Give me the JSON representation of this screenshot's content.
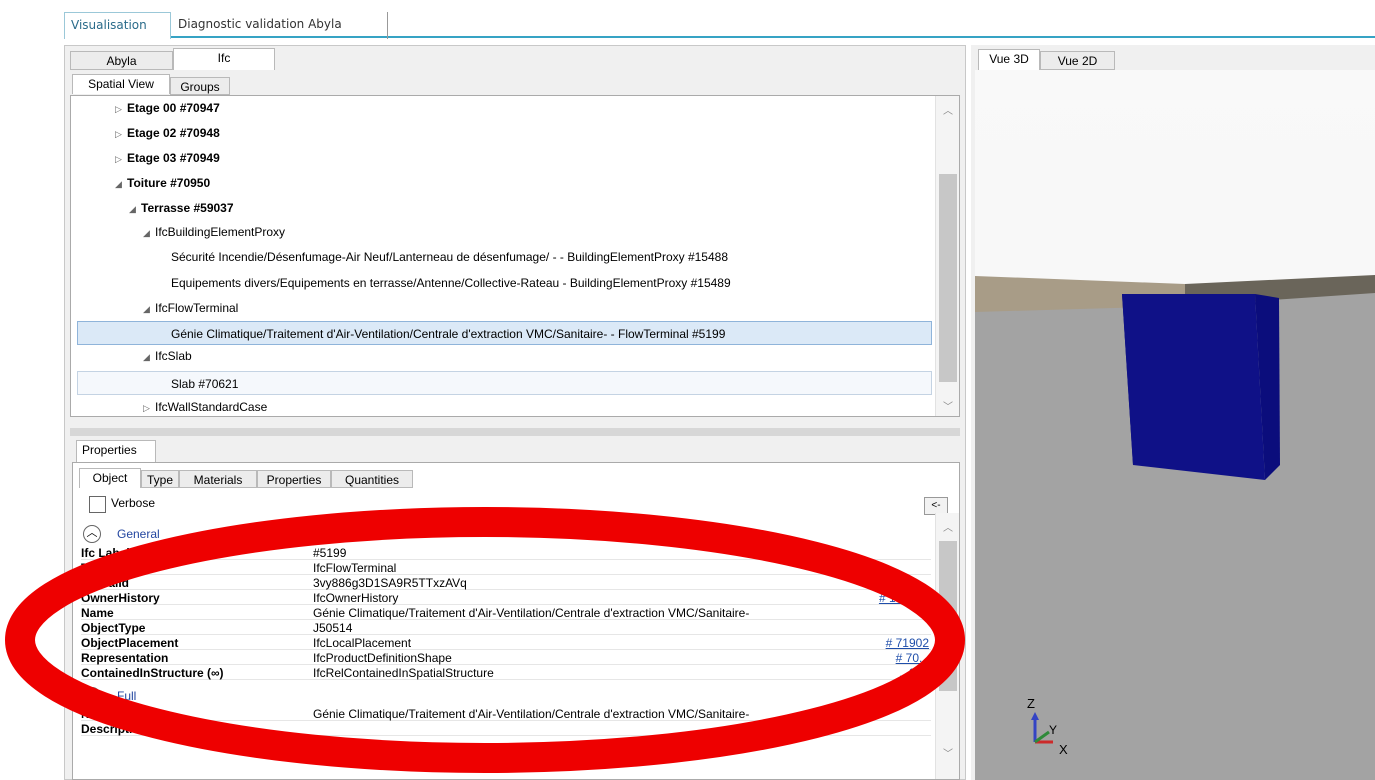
{
  "top_tabs": [
    "Visualisation",
    "Diagnostic validation Abyla"
  ],
  "left_tabs": [
    "Abyla",
    "Ifc"
  ],
  "sub_tabs": [
    "Spatial View",
    "Groups"
  ],
  "tree": [
    {
      "label": "Etage 00 #70947",
      "bold": true
    },
    {
      "label": "Etage 02 #70948",
      "bold": true
    },
    {
      "label": "Etage 03 #70949",
      "bold": true
    },
    {
      "label": "Toiture #70950",
      "bold": true
    },
    {
      "label": "Terrasse #59037",
      "bold": true
    },
    {
      "label": "IfcBuildingElementProxy",
      "bold": false
    },
    {
      "label": "Sécurité Incendie/Désenfumage-Air Neuf/Lanterneau de désenfumage/ - - BuildingElementProxy #15488",
      "bold": false
    },
    {
      "label": "Equipements divers/Equipements en terrasse/Antenne/Collective-Rateau - BuildingElementProxy #15489",
      "bold": false
    },
    {
      "label": "IfcFlowTerminal",
      "bold": false
    },
    {
      "label": "Génie Climatique/Traitement d'Air-Ventilation/Centrale d'extraction VMC/Sanitaire- - FlowTerminal #5199",
      "bold": false
    },
    {
      "label": "IfcSlab",
      "bold": false
    },
    {
      "label": "Slab #70621",
      "bold": false
    },
    {
      "label": "IfcWallStandardCase",
      "bold": false
    }
  ],
  "properties_tab": "Properties",
  "prop_tabs": [
    "Object",
    "Type",
    "Materials",
    "Properties",
    "Quantities"
  ],
  "verbose_label": "Verbose",
  "collapse_button": "<-",
  "general_section": "General",
  "general_rows": [
    {
      "key": "Ifc Label",
      "value": "#5199",
      "link": ""
    },
    {
      "key": "Type",
      "value": "IfcFlowTerminal",
      "link": ""
    },
    {
      "key": "GlobalId",
      "value": "3vy886g3D1SA9R5TTxzAVq",
      "link": ""
    },
    {
      "key": "OwnerHistory",
      "value": "IfcOwnerHistory",
      "link": "# 108206"
    },
    {
      "key": "Name",
      "value": "Génie Climatique/Traitement d'Air-Ventilation/Centrale d'extraction VMC/Sanitaire-",
      "link": ""
    },
    {
      "key": "ObjectType",
      "value": "J50514",
      "link": ""
    },
    {
      "key": "ObjectPlacement",
      "value": "IfcLocalPlacement",
      "link": "# 71902"
    },
    {
      "key": "Representation",
      "value": "IfcProductDefinitionShape",
      "link": "# 70..."
    },
    {
      "key": "ContainedInStructure (∞)",
      "value": "IfcRelContainedInSpatialStructure",
      "link": "...944"
    }
  ],
  "full_section": "Full",
  "full_rows": [
    {
      "key": "Name",
      "value": "Génie Climatique/Traitement d'Air-Ventilation/Centrale d'extraction VMC/Sanitaire-"
    },
    {
      "key": "Description",
      "value": ""
    }
  ],
  "view_tabs": [
    "Vue 3D",
    "Vue 2D"
  ],
  "axes": {
    "z": "Z",
    "y": "Y",
    "x": "X"
  },
  "colors": {
    "accent": "#36a3c4",
    "cube": "#0e0f86",
    "annotation": "#ee0000",
    "link": "#1f4eaa"
  }
}
